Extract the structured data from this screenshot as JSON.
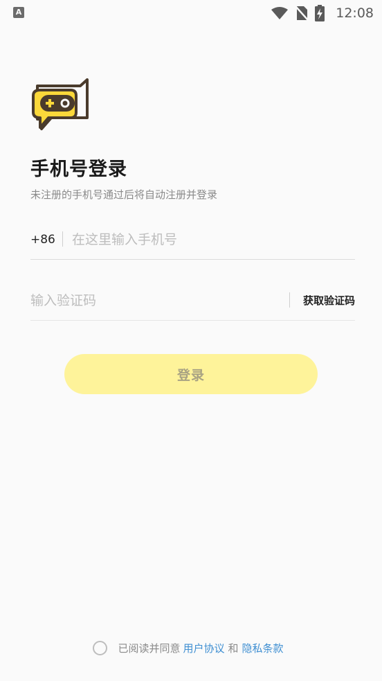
{
  "status_bar": {
    "app_icon_letter": "A",
    "time": "12:08"
  },
  "login": {
    "title": "手机号登录",
    "subtitle": "未注册的手机号通过后将自动注册并登录",
    "country_code": "+86",
    "phone_placeholder": "在这里输入手机号",
    "phone_value": "",
    "code_placeholder": "输入验证码",
    "code_value": "",
    "get_code_label": "获取验证码",
    "login_button_label": "登录"
  },
  "agreement": {
    "prefix": "已阅读并同意",
    "user_agreement": "用户协议",
    "and": "和",
    "privacy_policy": "隐私条款",
    "checked": false
  },
  "colors": {
    "accent": "#fef39a",
    "link": "#3f8fd2",
    "logo_yellow": "#fbd83a",
    "logo_dark": "#4a3b2c"
  },
  "icons": [
    "app-notification-icon",
    "wifi-icon",
    "no-sim-icon",
    "battery-charging-icon",
    "app-logo-icon"
  ]
}
